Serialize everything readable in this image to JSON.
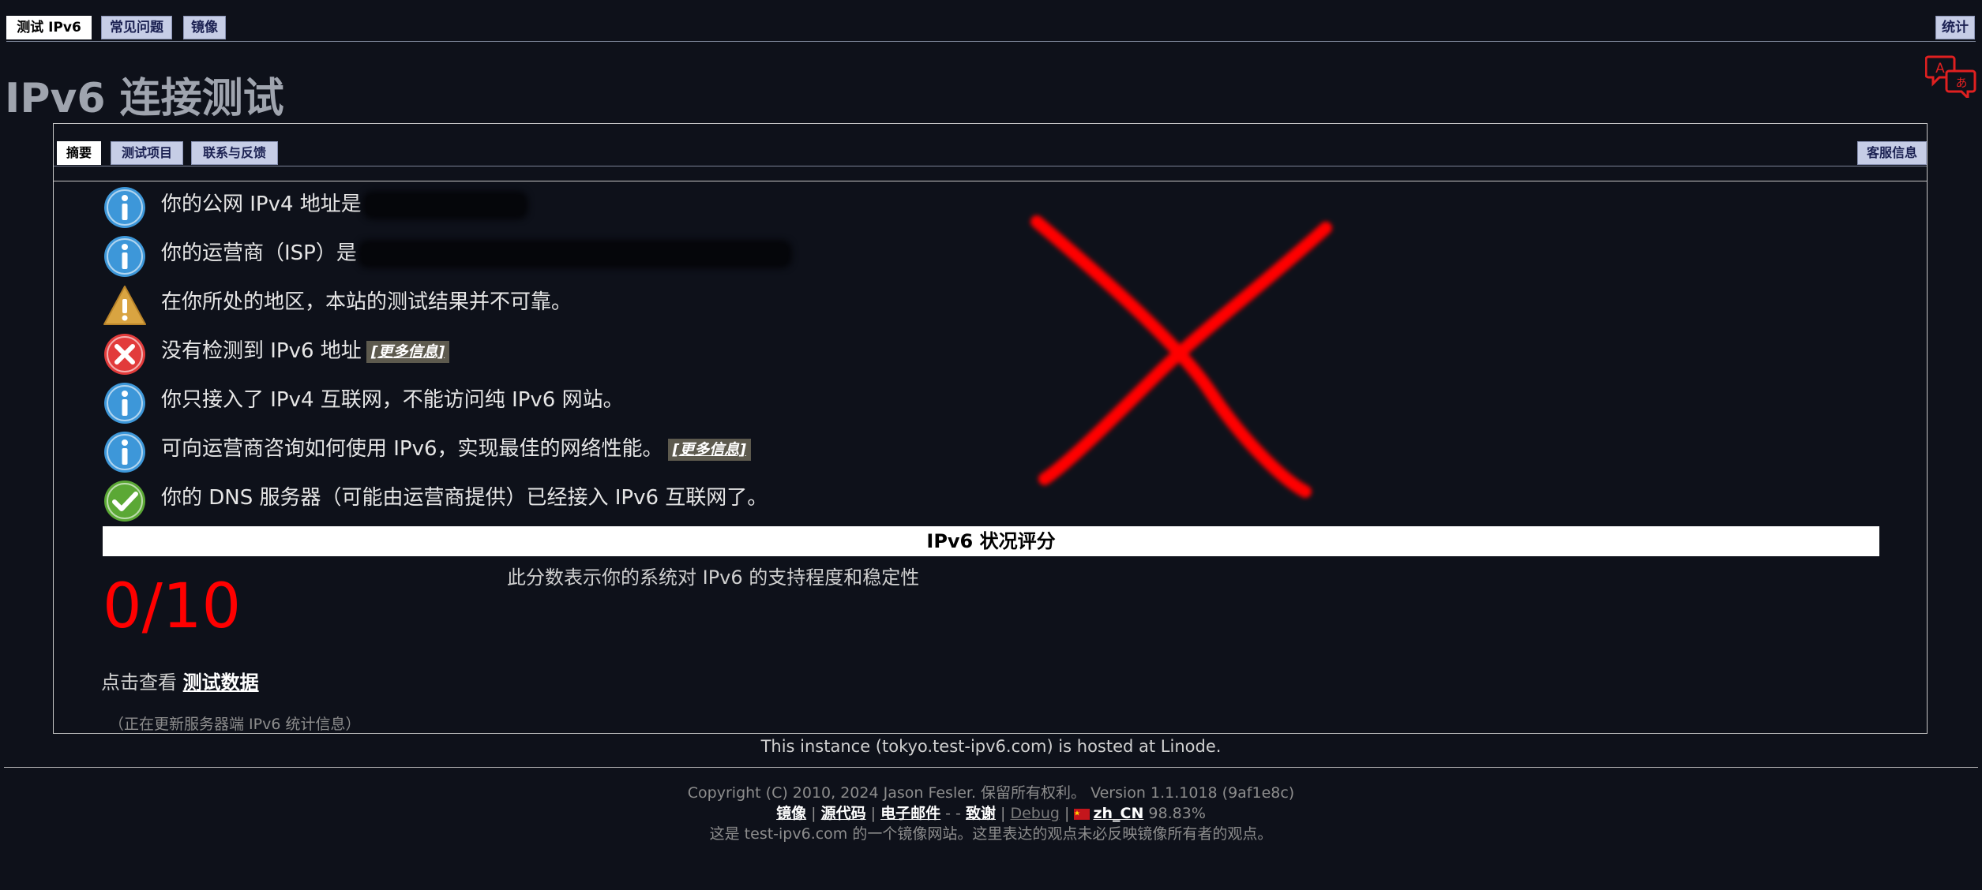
{
  "top_nav": {
    "tabs": [
      "测试 IPv6",
      "常见问题",
      "镜像"
    ],
    "stats": "统计",
    "language_icon": "translate-icon"
  },
  "page_title": "IPv6 连接测试",
  "sub_nav": {
    "tabs": [
      "摘要",
      "测试项目",
      "联系与反馈"
    ],
    "help_info": "客服信息"
  },
  "results": [
    {
      "icon": "info-icon",
      "text": "你的公网 IPv4 地址是",
      "redacted": true
    },
    {
      "icon": "info-icon",
      "text": "你的运营商（ISP）是",
      "redacted": true
    },
    {
      "icon": "warning-icon",
      "text": "在你所处的地区，本站的测试结果并不可靠。"
    },
    {
      "icon": "error-icon",
      "text": "没有检测到 IPv6 地址",
      "more": "[更多信息]"
    },
    {
      "icon": "info-icon",
      "text": "你只接入了 IPv4 互联网，不能访问纯 IPv6 网站。"
    },
    {
      "icon": "info-icon",
      "text": "可向运营商咨询如何使用 IPv6，实现最佳的网络性能。",
      "more": "[更多信息]"
    },
    {
      "icon": "check-icon",
      "text": "你的 DNS 服务器（可能由运营商提供）已经接入 IPv6 互联网了。"
    }
  ],
  "score_section": {
    "header": "IPv6 状况评分",
    "score": "0/10",
    "description": "此分数表示你的系统对 IPv6 的支持程度和稳定性",
    "view_prefix": "点击查看",
    "view_link": "测试数据",
    "stats_note": "（正在更新服务器端 IPv6 统计信息）"
  },
  "hosted_note": "This instance (tokyo.test-ipv6.com) is hosted at Linode.",
  "footer": {
    "copyright": "Copyright (C) 2010, 2024 Jason Fesler. 保留所有权利。 Version 1.1.1018 (9af1e8c)",
    "links": {
      "mirrors": "镜像",
      "source": "源代码",
      "email": "电子邮件",
      "thanks": "致谢",
      "debug": "Debug",
      "locale": "zh_CN",
      "percent": "98.83%"
    },
    "mirror_note": "这是 test-ipv6.com 的一个镜像网站。这里表达的观点未必反映镜像所有者的观点。"
  },
  "colors": {
    "background": "#0e111a",
    "score": "#ff0000",
    "tab": "#c6cde6",
    "info": "#3d97d9",
    "warning": "#d9a441",
    "error": "#e23b3b",
    "ok": "#5ba835"
  }
}
